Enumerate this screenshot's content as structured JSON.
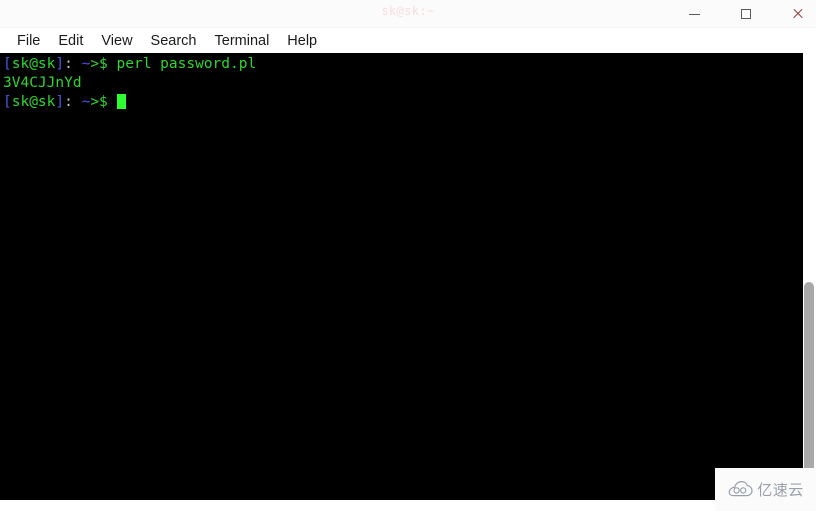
{
  "window": {
    "title": "sk@sk:~",
    "controls": {
      "minimize": "minimize-button",
      "maximize": "maximize-button",
      "close": "close-button"
    }
  },
  "menubar": {
    "items": [
      {
        "label": "File"
      },
      {
        "label": "Edit"
      },
      {
        "label": "View"
      },
      {
        "label": "Search"
      },
      {
        "label": "Terminal"
      },
      {
        "label": "Help"
      }
    ]
  },
  "terminal": {
    "prompt": {
      "open_bracket": "[",
      "user_host": "sk@sk",
      "close_bracket": "]",
      "colon": ":",
      "path": " ~",
      "arrow_dollar": ">$",
      "space": " "
    },
    "lines": [
      {
        "type": "command",
        "command": "perl password.pl"
      },
      {
        "type": "output",
        "text": "3V4CJJnYd"
      },
      {
        "type": "prompt-only",
        "command": ""
      }
    ]
  },
  "scrollbar": {
    "orientation": "vertical"
  },
  "watermark": {
    "text": "亿速云",
    "icon": "cloud-logo-icon",
    "color": "#9aa0ab"
  },
  "colors": {
    "terminal_background": "#000000",
    "prompt_green": "#2fd62f",
    "prompt_blue": "#4b57df",
    "cursor_green": "#2eff2e",
    "title_text": "#f6dede",
    "close_icon": "#8f2f2f",
    "scrollbar_thumb": "#a8a8a8"
  }
}
